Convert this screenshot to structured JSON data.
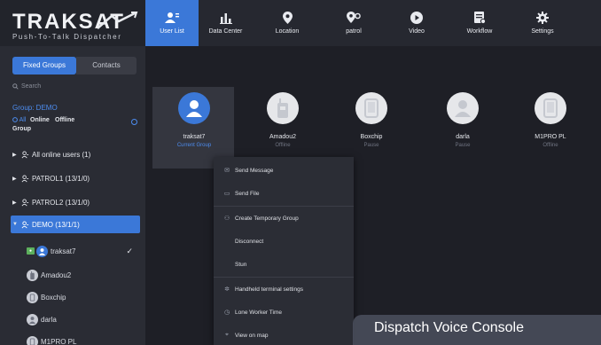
{
  "app": {
    "logo_text": "TRAKSAT",
    "tagline": "Push-To-Talk Dispatcher"
  },
  "sidebar": {
    "tabs": [
      {
        "label": "Fixed Groups",
        "active": true
      },
      {
        "label": "Contacts",
        "active": false
      }
    ],
    "search_placeholder": "Search",
    "group_label": "Group: DEMO",
    "filter": {
      "all": "All",
      "online": "Online",
      "offline": "Offline",
      "group": "Group"
    },
    "tree": [
      {
        "label": "All online users (1)",
        "expanded": false
      },
      {
        "label": "PATROL1 (13/1/0)",
        "expanded": false
      },
      {
        "label": "PATROL2 (13/1/0)",
        "expanded": false
      },
      {
        "label": "DEMO (13/1/1)",
        "expanded": true,
        "selected": true
      }
    ],
    "members": [
      {
        "name": "traksat7",
        "current": true
      },
      {
        "name": "Amadou2"
      },
      {
        "name": "Boxchip"
      },
      {
        "name": "darla"
      },
      {
        "name": "M1PRO PL"
      }
    ]
  },
  "nav": [
    {
      "label": "User List",
      "icon": "user-list-icon",
      "active": true
    },
    {
      "label": "Data Center",
      "icon": "bar-chart-icon"
    },
    {
      "label": "Location",
      "icon": "location-pin-icon"
    },
    {
      "label": "patrol",
      "icon": "patrol-icon"
    },
    {
      "label": "Video",
      "icon": "video-play-icon"
    },
    {
      "label": "Workflow",
      "icon": "workflow-icon"
    },
    {
      "label": "Settings",
      "icon": "gear-icon"
    }
  ],
  "users": [
    {
      "name": "traksat7",
      "status": "Current Group",
      "type": "person",
      "online": true
    },
    {
      "name": "Amadou2",
      "status": "Offline",
      "type": "radio",
      "online": false
    },
    {
      "name": "Boxchip",
      "status": "Pause",
      "type": "phone",
      "online": false
    },
    {
      "name": "darla",
      "status": "Pause",
      "type": "person",
      "online": false
    },
    {
      "name": "M1PRO PL",
      "status": "Offline",
      "type": "phone",
      "online": false
    }
  ],
  "context_menu": {
    "send_message": "Send Message",
    "send_file": "Send File",
    "create_temp_group": "Create Temporary Group",
    "disconnect": "Disconnect",
    "stun": "Stun",
    "handheld_settings": "Handheld terminal settings",
    "lone_worker": "Lone Worker Time",
    "view_on_map": "View on map"
  },
  "caption": "Dispatch Voice Console",
  "colors": {
    "accent": "#3b78d8",
    "sidebar_bg": "#2a2c34",
    "main_bg": "#1e1f26",
    "online_green": "#5db05d"
  }
}
